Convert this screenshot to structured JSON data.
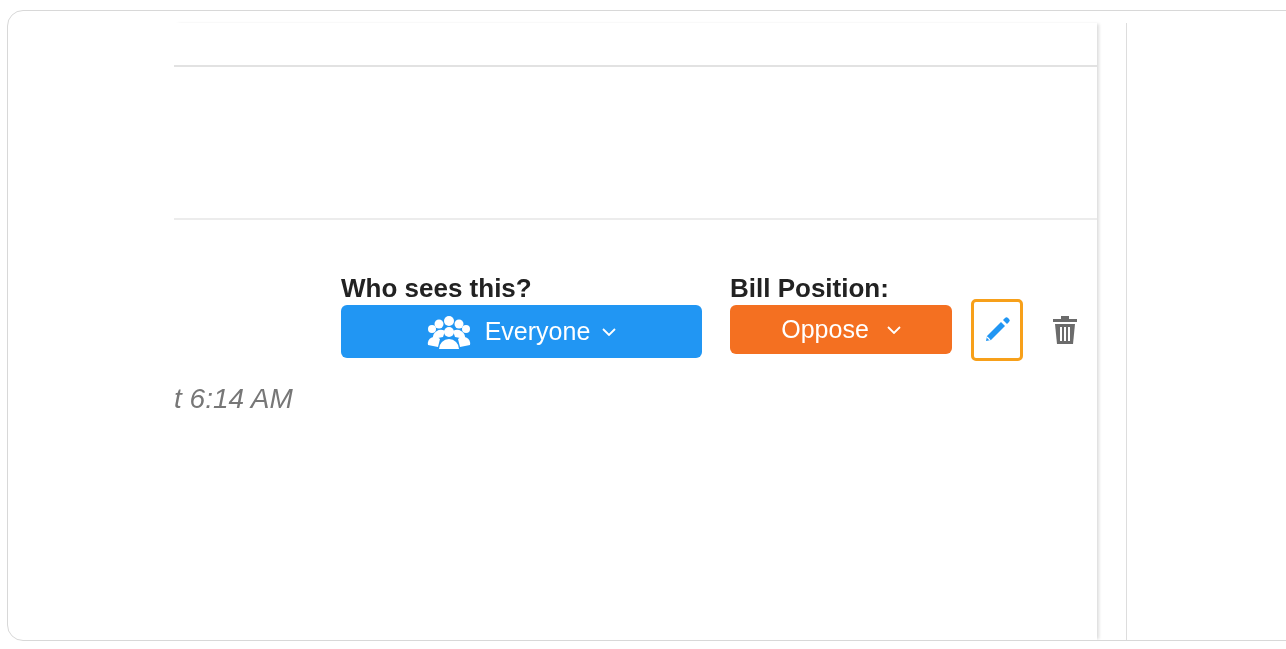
{
  "who_sees": {
    "label": "Who sees this?",
    "value": "Everyone"
  },
  "bill_position": {
    "label": "Bill Position:",
    "value": "Oppose"
  },
  "actions": [
    {
      "kind": "edit",
      "focused": true
    },
    {
      "kind": "delete",
      "focused": false
    }
  ],
  "timestamp": "t 6:14 AM"
}
